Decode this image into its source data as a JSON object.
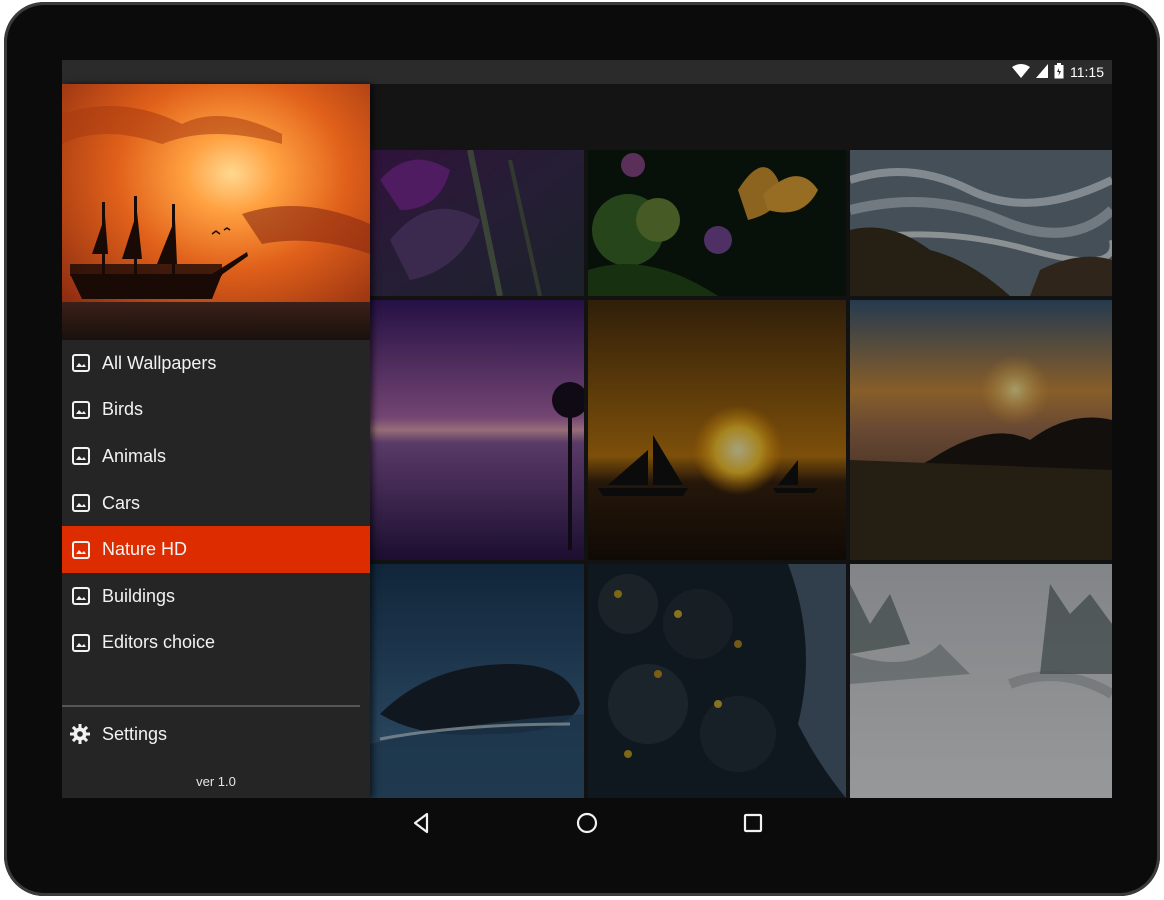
{
  "status_bar": {
    "time": "11:15",
    "icons": [
      "wifi-icon",
      "cell-signal-icon",
      "battery-icon"
    ]
  },
  "drawer": {
    "header_image": "sunset-sailing-ship",
    "items": [
      {
        "label": "All Wallpapers",
        "icon": "image-icon",
        "active": false
      },
      {
        "label": "Birds",
        "icon": "image-icon",
        "active": false
      },
      {
        "label": "Animals",
        "icon": "image-icon",
        "active": false
      },
      {
        "label": "Cars",
        "icon": "image-icon",
        "active": false
      },
      {
        "label": "Nature HD",
        "icon": "image-icon",
        "active": true
      },
      {
        "label": "Buildings",
        "icon": "image-icon",
        "active": false
      },
      {
        "label": "Editors choice",
        "icon": "image-icon",
        "active": false
      }
    ],
    "settings_label": "Settings",
    "version": "ver 1.0"
  },
  "wallpapers": [
    "purple-crocus",
    "butterfly-thistle",
    "ocean-waves-rocks",
    "purple-lake-dusk",
    "sailboats-sunset",
    "mountain-sunset-fog",
    "blue-rock-water",
    "stream-autumn-leaves",
    "misty-forest"
  ],
  "nav_bar": [
    "back-icon",
    "home-icon",
    "recents-icon"
  ],
  "colors": {
    "accent": "#dd2c00",
    "drawer_bg": "#252525",
    "status_bar_bg": "#2b2b2b"
  }
}
